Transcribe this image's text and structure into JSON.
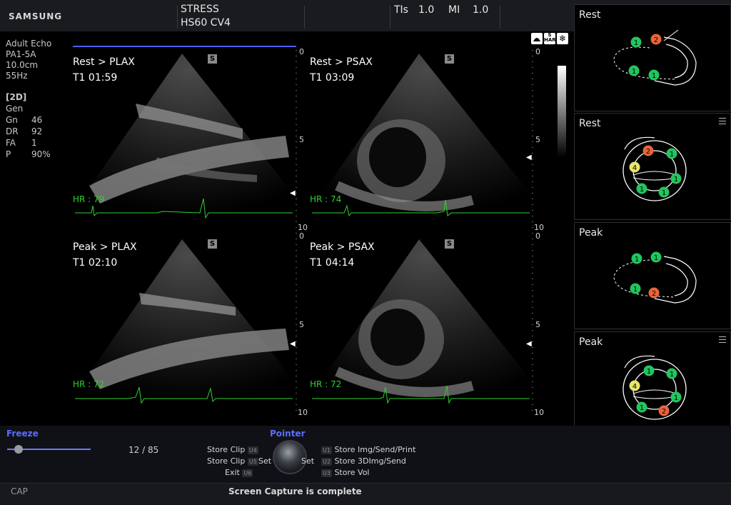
{
  "header": {
    "brand": "SAMSUNG",
    "title_line1": "STRESS",
    "title_line2": "HS60 CV4",
    "tis_label": "TIs",
    "tis_value": "1.0",
    "mi_label": "MI",
    "mi_value": "1.0"
  },
  "params": {
    "lines": [
      "Adult Echo",
      "PA1-5A",
      "10.0cm",
      "55Hz"
    ],
    "mode": "[2D]",
    "preset": "Gen",
    "rows": [
      {
        "label": "Gn",
        "value": "46"
      },
      {
        "label": "DR",
        "value": "92"
      },
      {
        "label": "FA",
        "value": "1"
      },
      {
        "label": "P",
        "value": "90%"
      }
    ]
  },
  "icons": {
    "top_right": [
      "probe-icon",
      "s-har-icon",
      "snowflake-icon"
    ],
    "s_har_text": "S\nHAR"
  },
  "panels": [
    {
      "label": "Rest > PLAX",
      "time": "T1 01:59",
      "hr": "HR : 79",
      "badge": "S"
    },
    {
      "label": "Rest > PSAX",
      "time": "T1 03:09",
      "hr": "HR : 74",
      "badge": "S"
    },
    {
      "label": "Peak > PLAX",
      "time": "T1 02:10",
      "hr": "HR : 72",
      "badge": "S"
    },
    {
      "label": "Peak > PSAX",
      "time": "T1 04:14",
      "hr": "HR : 72",
      "badge": "S"
    }
  ],
  "depth_scale": {
    "top": "0",
    "mid": "5",
    "bottom": "10"
  },
  "wall_motion": [
    {
      "title": "Rest",
      "view": "long-axis",
      "scores": [
        "1",
        "2",
        "1",
        "1"
      ],
      "has_menu": false
    },
    {
      "title": "Rest",
      "view": "short-axis",
      "scores": [
        "2",
        "1",
        "4",
        "1",
        "1",
        "1"
      ],
      "has_menu": true
    },
    {
      "title": "Peak",
      "view": "long-axis",
      "scores": [
        "1",
        "1",
        "1",
        "2"
      ],
      "has_menu": false
    },
    {
      "title": "Peak",
      "view": "short-axis",
      "scores": [
        "1",
        "1",
        "4",
        "1",
        "1",
        "2"
      ],
      "has_menu": true
    }
  ],
  "score_colors": {
    "1": "#22c55e",
    "2": "#e8643c",
    "4": "#e9e66a"
  },
  "bottom": {
    "freeze_label": "Freeze",
    "frame_counter": "12 / 85",
    "frame_position": 0.14,
    "pointer_label": "Pointer",
    "left_keys": [
      {
        "label": "Store Clip",
        "key": "U4"
      },
      {
        "label": "Store Clip",
        "key": "U5"
      },
      {
        "label": "Exit",
        "key": "U6"
      }
    ],
    "right_keys": [
      {
        "key": "U1",
        "label": "Store Img/Send/Print"
      },
      {
        "key": "U2",
        "label": "Store 3DImg/Send"
      },
      {
        "key": "U3",
        "label": "Store Vol"
      }
    ],
    "set_left": "Set",
    "set_right": "Set",
    "cap_label": "CAP",
    "status_message": "Screen Capture is complete"
  }
}
